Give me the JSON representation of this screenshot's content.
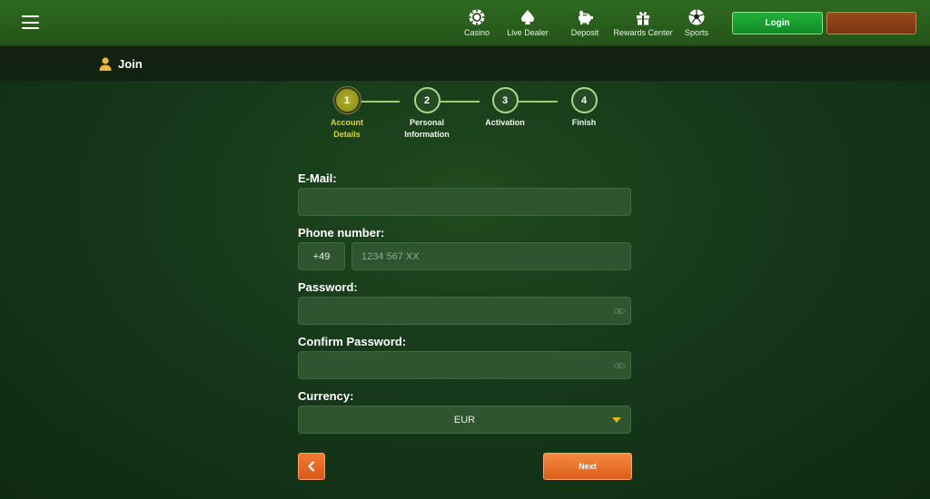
{
  "header": {
    "nav": [
      {
        "label": "Casino",
        "icon": "casino-chip-icon"
      },
      {
        "label": "Live Dealer",
        "icon": "spade-icon"
      },
      {
        "label": "Deposit",
        "icon": "piggy-bank-icon"
      },
      {
        "label": "Rewards Center",
        "icon": "gift-icon"
      },
      {
        "label": "Sports",
        "icon": "soccer-ball-icon"
      }
    ],
    "login_label": "Login",
    "register_label": ""
  },
  "page": {
    "title": "Join",
    "title_icon": "user-icon"
  },
  "stepper": {
    "current": 1,
    "steps": [
      {
        "number": "1",
        "label_line1": "Account",
        "label_line2": "Details"
      },
      {
        "number": "2",
        "label_line1": "Personal",
        "label_line2": "Information"
      },
      {
        "number": "3",
        "label_line1": "Activation",
        "label_line2": ""
      },
      {
        "number": "4",
        "label_line1": "Finish",
        "label_line2": ""
      }
    ]
  },
  "form": {
    "email": {
      "label": "E-Mail:",
      "value": "",
      "placeholder": ""
    },
    "phone": {
      "label": "Phone number:",
      "prefix": "+49",
      "value": "",
      "placeholder": "1234 567 XX"
    },
    "password": {
      "label": "Password:",
      "value": "",
      "placeholder": ""
    },
    "confirm_password": {
      "label": "Confirm Password:",
      "value": "",
      "placeholder": ""
    },
    "currency": {
      "label": "Currency:",
      "selected": "EUR"
    }
  },
  "actions": {
    "back_icon": "chevron-left-icon",
    "next_label": "Next"
  },
  "colors": {
    "accent_green": "#1fb23a",
    "accent_orange": "#f07a32",
    "active_step": "#b6b02a",
    "caret": "#e7b51d"
  }
}
